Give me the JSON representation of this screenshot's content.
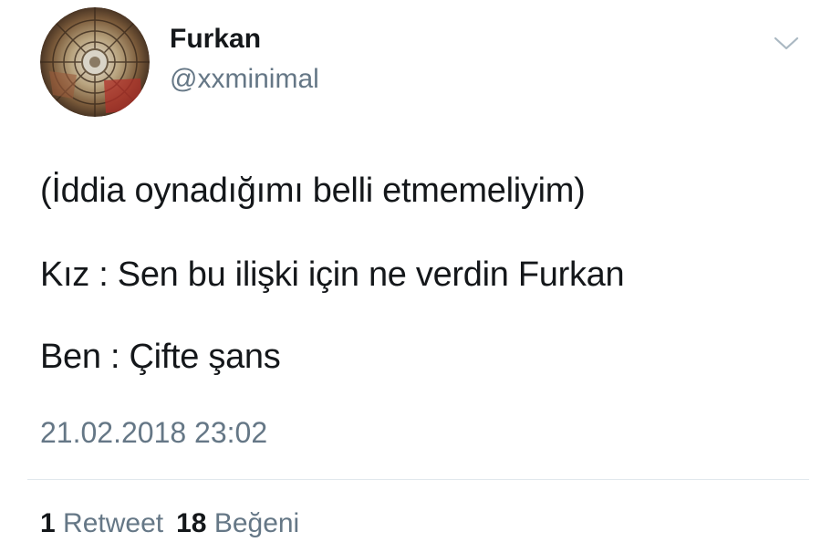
{
  "user": {
    "display_name": "Furkan",
    "handle": "@xxminimal"
  },
  "tweet": {
    "lines": [
      "(İddia oynadığımı belli etmemeliyim)",
      "Kız : Sen bu ilişki için ne verdin Furkan",
      "Ben : Çifte şans"
    ],
    "timestamp": "21.02.2018 23:02"
  },
  "stats": {
    "retweets": {
      "count": "1",
      "label": "Retweet"
    },
    "likes": {
      "count": "18",
      "label": "Beğeni"
    }
  },
  "icons": {
    "menu": "chevron-down-icon"
  },
  "colors": {
    "text_primary": "#14171a",
    "text_secondary": "#657786",
    "divider": "#e1e8ed"
  }
}
